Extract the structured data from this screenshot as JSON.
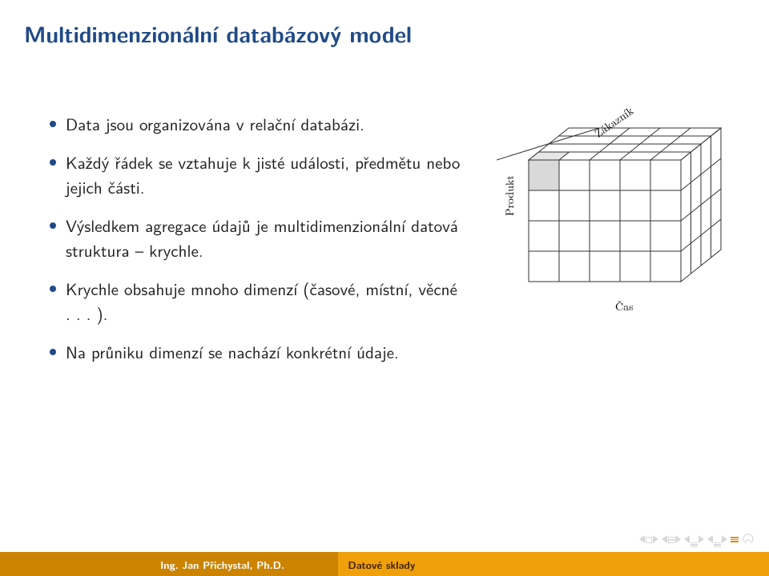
{
  "title": "Multidimenzionální databázový model",
  "bullets": [
    "Data jsou organizována v relační databázi.",
    "Každý řádek se vztahuje k jisté události, předmětu nebo jejich části.",
    "Výsledkem agregace údajů je multidimenzionální datová struktura – krychle.",
    "Krychle obsahuje mnoho dimenzí (časové, místní, věcné . . . ).",
    "Na průniku dimenzí se nachází konkrétní údaje."
  ],
  "cube": {
    "axis_y": "Produkt",
    "axis_x": "Čas",
    "axis_z": "Zákazník"
  },
  "footer": {
    "author": "Ing. Jan Přichystal, Ph.D.",
    "topic": "Datové sklady"
  }
}
